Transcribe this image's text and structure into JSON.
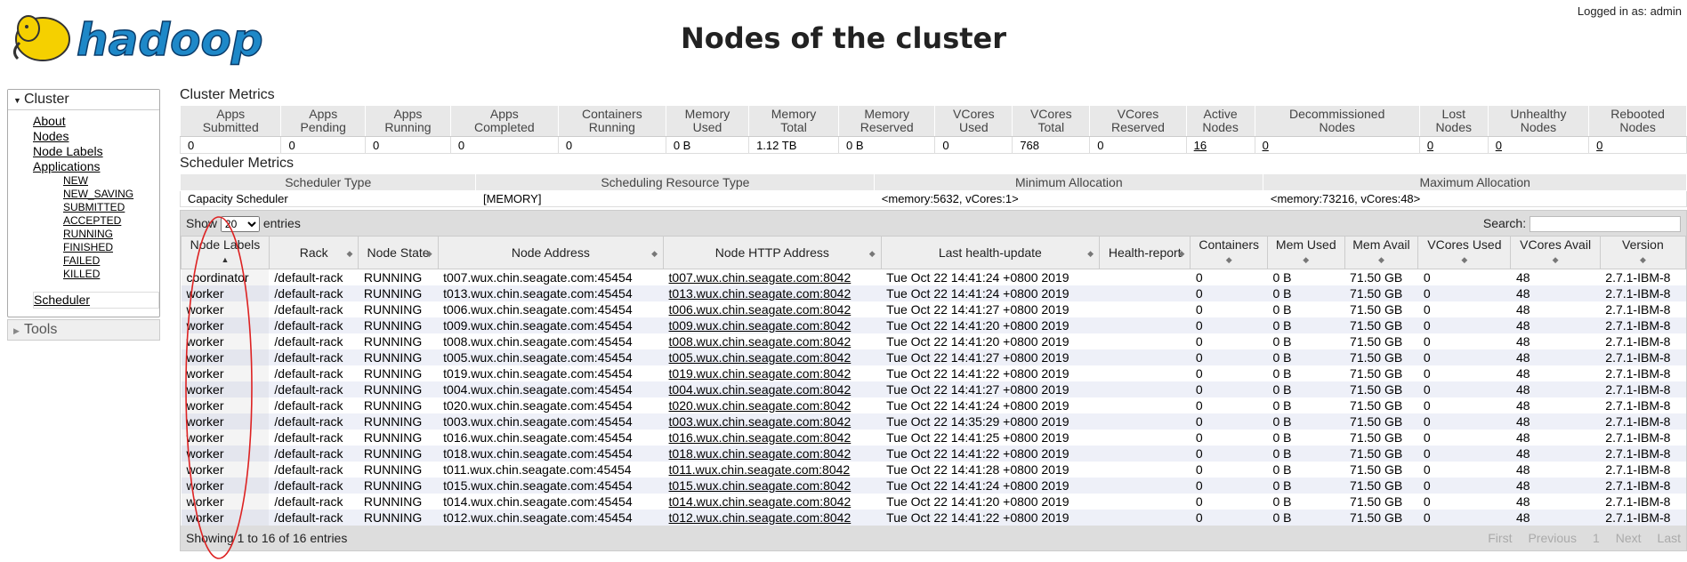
{
  "header": {
    "logo_text": "hadoop",
    "title": "Nodes of the cluster",
    "logged_in": "Logged in as: admin"
  },
  "nav": {
    "cluster_label": "Cluster",
    "items": [
      "About",
      "Nodes",
      "Node Labels",
      "Applications"
    ],
    "app_states": [
      "NEW",
      "NEW_SAVING",
      "SUBMITTED",
      "ACCEPTED",
      "RUNNING",
      "FINISHED",
      "FAILED",
      "KILLED"
    ],
    "scheduler": "Scheduler",
    "tools_label": "Tools"
  },
  "cluster_metrics": {
    "title": "Cluster Metrics",
    "headers": [
      [
        "Apps",
        "Submitted"
      ],
      [
        "Apps",
        "Pending"
      ],
      [
        "Apps",
        "Running"
      ],
      [
        "Apps",
        "Completed"
      ],
      [
        "Containers",
        "Running"
      ],
      [
        "Memory",
        "Used"
      ],
      [
        "Memory",
        "Total"
      ],
      [
        "Memory",
        "Reserved"
      ],
      [
        "VCores",
        "Used"
      ],
      [
        "VCores",
        "Total"
      ],
      [
        "VCores",
        "Reserved"
      ],
      [
        "Active",
        "Nodes"
      ],
      [
        "Decommissioned",
        "Nodes"
      ],
      [
        "Lost",
        "Nodes"
      ],
      [
        "Unhealthy",
        "Nodes"
      ],
      [
        "Rebooted",
        "Nodes"
      ]
    ],
    "values": [
      "0",
      "0",
      "0",
      "0",
      "0",
      "0 B",
      "1.12 TB",
      "0 B",
      "0",
      "768",
      "0",
      "16",
      "0",
      "0",
      "0",
      "0"
    ],
    "links": [
      false,
      false,
      false,
      false,
      false,
      false,
      false,
      false,
      false,
      false,
      false,
      true,
      true,
      true,
      true,
      true
    ]
  },
  "scheduler_metrics": {
    "title": "Scheduler Metrics",
    "headers": [
      "Scheduler Type",
      "Scheduling Resource Type",
      "Minimum Allocation",
      "Maximum Allocation"
    ],
    "values": [
      "Capacity Scheduler",
      "[MEMORY]",
      "<memory:5632, vCores:1>",
      "<memory:73216, vCores:48>"
    ]
  },
  "toolbar": {
    "show_label": "Show",
    "entries_value": "20",
    "entries_label": "entries",
    "search_label": "Search:"
  },
  "nodes_table": {
    "columns": [
      [
        "Node Labels",
        ""
      ],
      [
        "Rack",
        ""
      ],
      [
        "Node State",
        ""
      ],
      [
        "Node Address",
        ""
      ],
      [
        "Node HTTP Address",
        ""
      ],
      [
        "Last health-update",
        ""
      ],
      [
        "Health-report",
        ""
      ],
      [
        "Containers",
        ""
      ],
      [
        "Mem Used",
        ""
      ],
      [
        "Mem Avail",
        ""
      ],
      [
        "VCores Used",
        ""
      ],
      [
        "VCores Avail",
        ""
      ],
      [
        "Version",
        ""
      ]
    ],
    "rows": [
      [
        "coordinator",
        "/default-rack",
        "RUNNING",
        "t007.wux.chin.seagate.com:45454",
        "t007.wux.chin.seagate.com:8042",
        "Tue Oct 22 14:41:24 +0800 2019",
        "",
        "0",
        "0 B",
        "71.50 GB",
        "0",
        "48",
        "2.7.1-IBM-8"
      ],
      [
        "worker",
        "/default-rack",
        "RUNNING",
        "t013.wux.chin.seagate.com:45454",
        "t013.wux.chin.seagate.com:8042",
        "Tue Oct 22 14:41:24 +0800 2019",
        "",
        "0",
        "0 B",
        "71.50 GB",
        "0",
        "48",
        "2.7.1-IBM-8"
      ],
      [
        "worker",
        "/default-rack",
        "RUNNING",
        "t006.wux.chin.seagate.com:45454",
        "t006.wux.chin.seagate.com:8042",
        "Tue Oct 22 14:41:27 +0800 2019",
        "",
        "0",
        "0 B",
        "71.50 GB",
        "0",
        "48",
        "2.7.1-IBM-8"
      ],
      [
        "worker",
        "/default-rack",
        "RUNNING",
        "t009.wux.chin.seagate.com:45454",
        "t009.wux.chin.seagate.com:8042",
        "Tue Oct 22 14:41:20 +0800 2019",
        "",
        "0",
        "0 B",
        "71.50 GB",
        "0",
        "48",
        "2.7.1-IBM-8"
      ],
      [
        "worker",
        "/default-rack",
        "RUNNING",
        "t008.wux.chin.seagate.com:45454",
        "t008.wux.chin.seagate.com:8042",
        "Tue Oct 22 14:41:20 +0800 2019",
        "",
        "0",
        "0 B",
        "71.50 GB",
        "0",
        "48",
        "2.7.1-IBM-8"
      ],
      [
        "worker",
        "/default-rack",
        "RUNNING",
        "t005.wux.chin.seagate.com:45454",
        "t005.wux.chin.seagate.com:8042",
        "Tue Oct 22 14:41:27 +0800 2019",
        "",
        "0",
        "0 B",
        "71.50 GB",
        "0",
        "48",
        "2.7.1-IBM-8"
      ],
      [
        "worker",
        "/default-rack",
        "RUNNING",
        "t019.wux.chin.seagate.com:45454",
        "t019.wux.chin.seagate.com:8042",
        "Tue Oct 22 14:41:22 +0800 2019",
        "",
        "0",
        "0 B",
        "71.50 GB",
        "0",
        "48",
        "2.7.1-IBM-8"
      ],
      [
        "worker",
        "/default-rack",
        "RUNNING",
        "t004.wux.chin.seagate.com:45454",
        "t004.wux.chin.seagate.com:8042",
        "Tue Oct 22 14:41:27 +0800 2019",
        "",
        "0",
        "0 B",
        "71.50 GB",
        "0",
        "48",
        "2.7.1-IBM-8"
      ],
      [
        "worker",
        "/default-rack",
        "RUNNING",
        "t020.wux.chin.seagate.com:45454",
        "t020.wux.chin.seagate.com:8042",
        "Tue Oct 22 14:41:24 +0800 2019",
        "",
        "0",
        "0 B",
        "71.50 GB",
        "0",
        "48",
        "2.7.1-IBM-8"
      ],
      [
        "worker",
        "/default-rack",
        "RUNNING",
        "t003.wux.chin.seagate.com:45454",
        "t003.wux.chin.seagate.com:8042",
        "Tue Oct 22 14:35:29 +0800 2019",
        "",
        "0",
        "0 B",
        "71.50 GB",
        "0",
        "48",
        "2.7.1-IBM-8"
      ],
      [
        "worker",
        "/default-rack",
        "RUNNING",
        "t016.wux.chin.seagate.com:45454",
        "t016.wux.chin.seagate.com:8042",
        "Tue Oct 22 14:41:25 +0800 2019",
        "",
        "0",
        "0 B",
        "71.50 GB",
        "0",
        "48",
        "2.7.1-IBM-8"
      ],
      [
        "worker",
        "/default-rack",
        "RUNNING",
        "t018.wux.chin.seagate.com:45454",
        "t018.wux.chin.seagate.com:8042",
        "Tue Oct 22 14:41:22 +0800 2019",
        "",
        "0",
        "0 B",
        "71.50 GB",
        "0",
        "48",
        "2.7.1-IBM-8"
      ],
      [
        "worker",
        "/default-rack",
        "RUNNING",
        "t011.wux.chin.seagate.com:45454",
        "t011.wux.chin.seagate.com:8042",
        "Tue Oct 22 14:41:28 +0800 2019",
        "",
        "0",
        "0 B",
        "71.50 GB",
        "0",
        "48",
        "2.7.1-IBM-8"
      ],
      [
        "worker",
        "/default-rack",
        "RUNNING",
        "t015.wux.chin.seagate.com:45454",
        "t015.wux.chin.seagate.com:8042",
        "Tue Oct 22 14:41:24 +0800 2019",
        "",
        "0",
        "0 B",
        "71.50 GB",
        "0",
        "48",
        "2.7.1-IBM-8"
      ],
      [
        "worker",
        "/default-rack",
        "RUNNING",
        "t014.wux.chin.seagate.com:45454",
        "t014.wux.chin.seagate.com:8042",
        "Tue Oct 22 14:41:20 +0800 2019",
        "",
        "0",
        "0 B",
        "71.50 GB",
        "0",
        "48",
        "2.7.1-IBM-8"
      ],
      [
        "worker",
        "/default-rack",
        "RUNNING",
        "t012.wux.chin.seagate.com:45454",
        "t012.wux.chin.seagate.com:8042",
        "Tue Oct 22 14:41:22 +0800 2019",
        "",
        "0",
        "0 B",
        "71.50 GB",
        "0",
        "48",
        "2.7.1-IBM-8"
      ]
    ]
  },
  "footer": {
    "showing": "Showing 1 to 16 of 16 entries",
    "pager": [
      "First",
      "Previous",
      "1",
      "Next",
      "Last"
    ]
  },
  "colors": {
    "annotation": "#dd2222",
    "logo_blue": "#1e88c8",
    "logo_yellow": "#f5d000"
  }
}
